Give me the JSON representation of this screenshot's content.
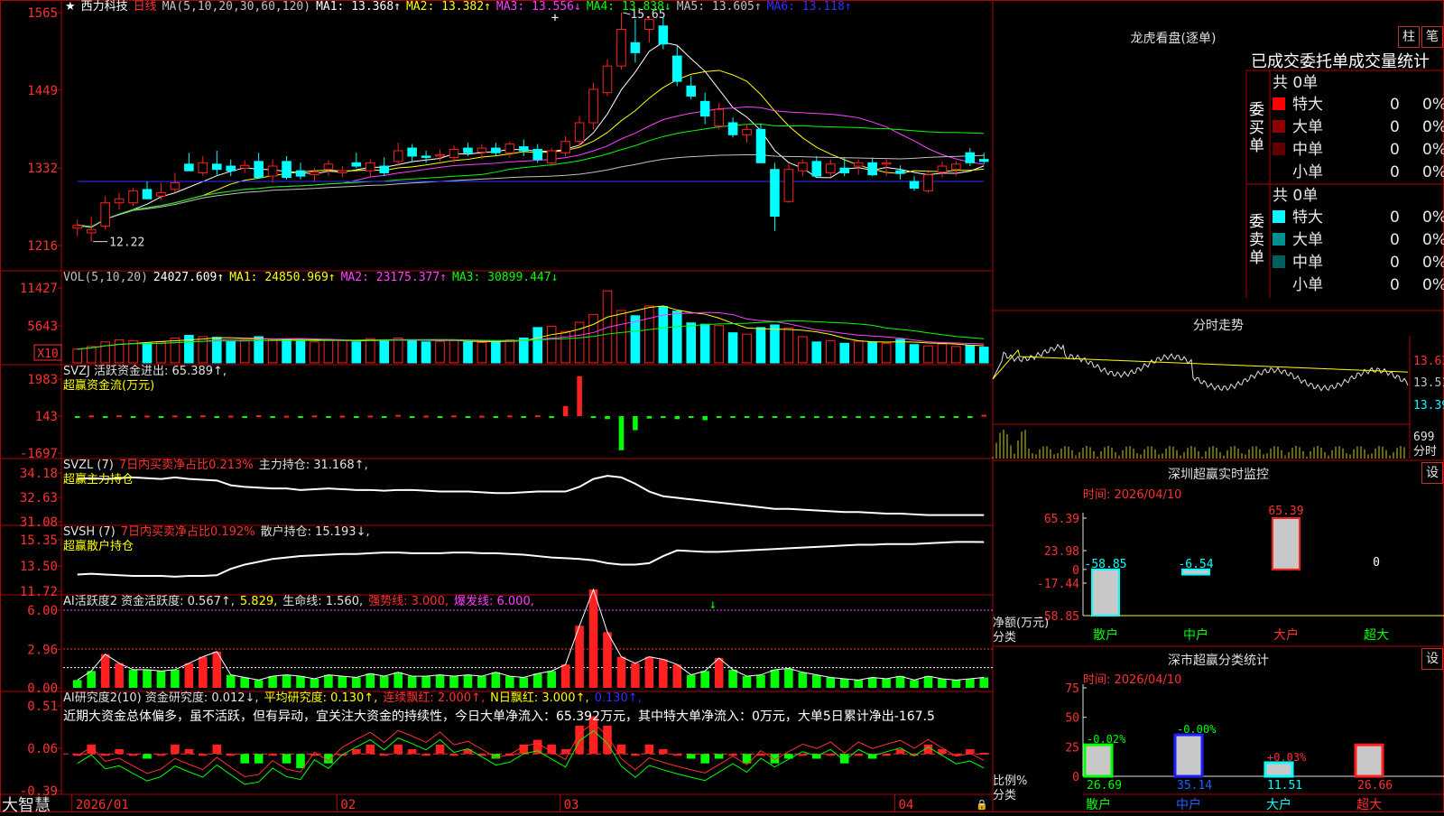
{
  "stock": {
    "name": "西力科技",
    "period": "日线"
  },
  "main": {
    "ma_header": "MA(5,10,20,30,60,120)",
    "ma": [
      {
        "label": "MA1: 13.368↑",
        "color": "#ffffff"
      },
      {
        "label": "MA2: 13.382↑",
        "color": "#ffff00"
      },
      {
        "label": "MA3: 13.556↓",
        "color": "#ff40ff"
      },
      {
        "label": "MA4: 13.838↓",
        "color": "#00ff00"
      },
      {
        "label": "MA5: 13.605↑",
        "color": "#c0c0c0"
      },
      {
        "label": "MA6: 13.118↑",
        "color": "#3030ff"
      }
    ],
    "y_ticks": [
      "1565",
      "1449",
      "1332",
      "1216"
    ],
    "high_label": "15.65",
    "low_label": "12.22"
  },
  "vol": {
    "header": "VOL(5,10,20)",
    "value": "24027.609↑",
    "ma": [
      {
        "label": "MA1: 24850.969↑",
        "color": "#ffff00"
      },
      {
        "label": "MA2: 23175.377↑",
        "color": "#ff40ff"
      },
      {
        "label": "MA3: 30899.447↓",
        "color": "#00ff00"
      }
    ],
    "y_ticks": [
      "11427",
      "5643"
    ],
    "unit": "X10"
  },
  "svzj": {
    "header": "SVZJ  活跃资金进出: 65.389↑,",
    "sub": "超赢资金流(万元)",
    "y_ticks": [
      "1983",
      "143",
      "-1697"
    ]
  },
  "svzl": {
    "header_a": "SVZL (7)",
    "header_b": "7日内买卖净占比0.213%",
    "header_c": "主力持仓: 31.168↑,",
    "sub": "超赢主力持仓",
    "y_ticks": [
      "34.18",
      "32.63",
      "31.08"
    ]
  },
  "svsh": {
    "header_a": "SVSH (7)",
    "header_b": "7日内买卖净占比0.192%",
    "header_c": "散户持仓: 15.193↓,",
    "sub": "超赢散户持仓",
    "y_ticks": [
      "15.35",
      "13.50",
      "11.72"
    ]
  },
  "ai2": {
    "header_a": "AI活跃度2 资金活跃度: 0.567↑,",
    "header_b": "5.829,",
    "header_c": "生命线: 1.560,",
    "header_d": "强势线: 3.000,",
    "header_e": "爆发线: 6.000,",
    "y_ticks": [
      "6.00",
      "2.96",
      "0.00"
    ]
  },
  "ai3": {
    "header_a": "AI研究度2(10) 资金研究度: 0.012↓,",
    "header_b": "平均研究度: 0.130↑,",
    "header_c": "连续飘红: 2.000↑,",
    "header_d": "N日飘红: 3.000↑,",
    "header_e": "0.130↑,",
    "comment": "近期大资金总体偏多，虽不活跃，但有异动，宜关注大资金的持续性，今日大单净流入：65.392万元，其中特大单净流入：0万元，大单5日累计净出-167.5",
    "y_ticks": [
      "0.51",
      "0.06",
      "-0.39"
    ]
  },
  "xaxis": {
    "labels": [
      "2026/01",
      "02",
      "03",
      "04"
    ]
  },
  "brand": "大智慧",
  "right": {
    "lhkp_title": "龙虎看盘(逐单)",
    "btn_zhu": "柱",
    "btn_bi": "笔",
    "stat_title": "已成交委托单成交量统计",
    "buy_label": "委买单",
    "sell_label": "委卖单",
    "buy_total": "共 0单",
    "sell_total": "共 0单",
    "buy_rows": [
      {
        "label": "特大",
        "val": "0",
        "pct": "0%",
        "color": "#ff0000"
      },
      {
        "label": "大单",
        "val": "0",
        "pct": "0%",
        "color": "#900000"
      },
      {
        "label": "中单",
        "val": "0",
        "pct": "0%",
        "color": "#600000"
      },
      {
        "label": "小单",
        "val": "0",
        "pct": "0%",
        "color": "#000000"
      }
    ],
    "sell_rows": [
      {
        "label": "特大",
        "val": "0",
        "pct": "0%",
        "color": "#00ffff"
      },
      {
        "label": "大单",
        "val": "0",
        "pct": "0%",
        "color": "#009090"
      },
      {
        "label": "中单",
        "val": "0",
        "pct": "0%",
        "color": "#006060"
      },
      {
        "label": "小单",
        "val": "0",
        "pct": "0%",
        "color": "#000000"
      }
    ],
    "fst_title": "分时走势",
    "fst_labels": [
      "13.63",
      "13.51",
      "13.39"
    ],
    "fst_vol": "699",
    "fst_vol_unit": "分时",
    "sz_title": "深圳超赢实时监控",
    "btn_she": "设",
    "sz_time": "时间: 2026/04/10",
    "sz_ticks": [
      "65.39",
      "23.98",
      "0",
      "-17.44",
      "-58.85"
    ],
    "sz_values": [
      {
        "cat": "散户",
        "val": -58.85,
        "label": "-58.85",
        "color": "#00ffff"
      },
      {
        "cat": "中户",
        "val": -6.54,
        "label": "-6.54",
        "color": "#00ffff"
      },
      {
        "cat": "大户",
        "val": 65.39,
        "label": "65.39",
        "color": "#ff2020"
      },
      {
        "cat": "超大",
        "val": 0,
        "label": "0",
        "color": "#ffffff"
      }
    ],
    "sz_ylabel": "净额(万元)",
    "sz_xlabel": "分类",
    "ss_title": "深市超赢分类统计",
    "ss_time": "时间: 2026/04/10",
    "ss_ticks": [
      "75",
      "50",
      "25",
      "0"
    ],
    "ss_values": [
      {
        "cat": "散户",
        "val": 26.69,
        "label": "26.69",
        "delta": "-0.02%",
        "color": "#00ff00"
      },
      {
        "cat": "中户",
        "val": 35.14,
        "label": "35.14",
        "delta": "-0.00%",
        "color": "#2020ff"
      },
      {
        "cat": "大户",
        "val": 11.51,
        "label": "11.51",
        "delta": "+0.03%",
        "color": "#00ffff"
      },
      {
        "cat": "超大",
        "val": 26.66,
        "label": "26.66",
        "delta": "",
        "color": "#ff2020"
      }
    ],
    "ss_ylabel": "比例%",
    "ss_xlabel": "分类"
  },
  "colors": {
    "up": "#ff2020",
    "down": "#00ffff",
    "grid": "#b00000",
    "label": "#ff3030"
  },
  "chart_data": {
    "type": "candlestick",
    "ylim": [
      12.16,
      15.65
    ],
    "candles": [
      [
        12.42,
        12.55,
        12.3,
        12.46
      ],
      [
        12.35,
        12.6,
        12.22,
        12.4
      ],
      [
        12.45,
        12.9,
        12.4,
        12.8
      ],
      [
        12.8,
        12.95,
        12.7,
        12.86
      ],
      [
        12.8,
        13.02,
        12.75,
        12.98
      ],
      [
        13.0,
        13.12,
        12.9,
        12.86
      ],
      [
        12.9,
        13.1,
        12.85,
        12.95
      ],
      [
        13.0,
        13.25,
        12.95,
        13.1
      ],
      [
        13.38,
        13.55,
        13.3,
        13.28
      ],
      [
        13.25,
        13.5,
        13.2,
        13.4
      ],
      [
        13.38,
        13.58,
        13.2,
        13.3
      ],
      [
        13.35,
        13.45,
        13.2,
        13.28
      ],
      [
        13.32,
        13.44,
        13.25,
        13.36
      ],
      [
        13.42,
        13.55,
        13.2,
        13.18
      ],
      [
        13.2,
        13.45,
        13.1,
        13.35
      ],
      [
        13.42,
        13.5,
        13.15,
        13.18
      ],
      [
        13.28,
        13.4,
        13.15,
        13.2
      ],
      [
        13.22,
        13.32,
        13.12,
        13.26
      ],
      [
        13.3,
        13.44,
        13.2,
        13.38
      ],
      [
        13.25,
        13.35,
        13.18,
        13.28
      ],
      [
        13.4,
        13.55,
        13.32,
        13.35
      ],
      [
        13.28,
        13.45,
        13.18,
        13.4
      ],
      [
        13.35,
        13.48,
        13.2,
        13.25
      ],
      [
        13.42,
        13.7,
        13.35,
        13.58
      ],
      [
        13.62,
        13.68,
        13.42,
        13.5
      ],
      [
        13.5,
        13.58,
        13.4,
        13.48
      ],
      [
        13.5,
        13.6,
        13.42,
        13.52
      ],
      [
        13.48,
        13.66,
        13.4,
        13.6
      ],
      [
        13.62,
        13.7,
        13.5,
        13.55
      ],
      [
        13.56,
        13.68,
        13.45,
        13.62
      ],
      [
        13.62,
        13.7,
        13.5,
        13.55
      ],
      [
        13.55,
        13.72,
        13.48,
        13.68
      ],
      [
        13.64,
        13.75,
        13.5,
        13.58
      ],
      [
        13.6,
        13.68,
        13.4,
        13.45
      ],
      [
        13.4,
        13.62,
        13.35,
        13.58
      ],
      [
        13.55,
        13.8,
        13.5,
        13.72
      ],
      [
        13.72,
        14.1,
        13.65,
        14.0
      ],
      [
        14.0,
        14.6,
        13.9,
        14.5
      ],
      [
        14.45,
        14.95,
        14.4,
        14.85
      ],
      [
        14.85,
        15.65,
        14.8,
        15.4
      ],
      [
        15.2,
        15.55,
        14.9,
        15.05
      ],
      [
        15.4,
        15.6,
        15.2,
        15.55
      ],
      [
        15.45,
        15.58,
        15.1,
        15.18
      ],
      [
        15.0,
        15.15,
        14.55,
        14.62
      ],
      [
        14.55,
        14.7,
        14.35,
        14.4
      ],
      [
        14.32,
        14.45,
        13.98,
        14.1
      ],
      [
        13.95,
        14.3,
        13.9,
        14.2
      ],
      [
        14.0,
        14.08,
        13.78,
        13.82
      ],
      [
        13.82,
        13.98,
        13.7,
        13.9
      ],
      [
        13.9,
        13.98,
        13.4,
        13.4
      ],
      [
        13.3,
        13.4,
        12.38,
        12.6
      ],
      [
        12.82,
        13.38,
        12.8,
        13.3
      ],
      [
        13.28,
        13.45,
        13.2,
        13.4
      ],
      [
        13.42,
        13.5,
        13.2,
        13.2
      ],
      [
        13.25,
        13.45,
        13.18,
        13.38
      ],
      [
        13.32,
        13.48,
        13.2,
        13.25
      ],
      [
        13.35,
        13.45,
        13.22,
        13.4
      ],
      [
        13.4,
        13.48,
        13.2,
        13.22
      ],
      [
        13.38,
        13.45,
        13.2,
        13.4
      ],
      [
        13.28,
        13.36,
        13.15,
        13.24
      ],
      [
        13.12,
        13.2,
        12.98,
        13.02
      ],
      [
        12.98,
        13.26,
        12.95,
        13.22
      ],
      [
        13.26,
        13.42,
        13.18,
        13.35
      ],
      [
        13.3,
        13.42,
        13.2,
        13.38
      ],
      [
        13.55,
        13.62,
        13.35,
        13.4
      ],
      [
        13.45,
        13.55,
        13.38,
        13.42
      ]
    ],
    "volumes": [
      2.1,
      2.5,
      3.2,
      3.5,
      3.4,
      3.0,
      3.2,
      3.8,
      4.2,
      4.0,
      3.9,
      3.3,
      3.4,
      4.0,
      3.5,
      3.6,
      3.4,
      3.2,
      3.6,
      3.4,
      3.2,
      3.7,
      3.3,
      3.8,
      3.5,
      3.2,
      3.3,
      3.4,
      3.2,
      3.1,
      3.3,
      3.5,
      3.8,
      5.4,
      5.6,
      4.8,
      6.2,
      7.4,
      11.0,
      8.0,
      7.2,
      8.7,
      8.6,
      7.9,
      6.1,
      5.9,
      5.7,
      4.6,
      4.4,
      5.4,
      5.8,
      5.3,
      4.0,
      3.2,
      3.4,
      3.0,
      3.3,
      3.2,
      3.0,
      3.6,
      2.8,
      2.6,
      2.9,
      2.5,
      2.7,
      2.4
    ],
    "flows": [
      -40,
      30,
      -20,
      40,
      -30,
      25,
      -40,
      30,
      -20,
      35,
      -30,
      25,
      -60,
      40,
      -35,
      20,
      -25,
      30,
      -45,
      20,
      -30,
      25,
      -35,
      60,
      -30,
      25,
      -20,
      30,
      -40,
      20,
      -35,
      30,
      -25,
      40,
      -60,
      500,
      1983,
      -50,
      -150,
      -1697,
      -700,
      -120,
      -40,
      -150,
      -30,
      -200,
      -60,
      -50,
      -40,
      -70,
      -45,
      -30,
      -40,
      -35,
      -50,
      -60,
      -40,
      -30,
      -45,
      -30,
      -40,
      -35,
      -60,
      -40,
      -30,
      65
    ],
    "zl": [
      33.8,
      33.85,
      33.8,
      33.85,
      33.9,
      33.85,
      33.8,
      33.9,
      33.8,
      33.75,
      33.7,
      33.4,
      33.3,
      33.25,
      33.2,
      33.2,
      33.1,
      33.15,
      33.2,
      33.15,
      33.1,
      33.1,
      33.05,
      33.1,
      33.1,
      33.05,
      33.0,
      33.0,
      33.0,
      32.95,
      32.9,
      32.9,
      32.95,
      33.0,
      33.0,
      33.0,
      33.3,
      33.8,
      34.0,
      33.9,
      33.5,
      33.0,
      32.7,
      32.6,
      32.5,
      32.4,
      32.3,
      32.2,
      32.1,
      32.0,
      31.9,
      31.9,
      31.85,
      31.8,
      31.75,
      31.7,
      31.7,
      31.65,
      31.6,
      31.6,
      31.55,
      31.5,
      31.5,
      31.5,
      31.5,
      31.5
    ],
    "sh": [
      12.9,
      12.95,
      12.9,
      12.85,
      12.8,
      12.8,
      12.8,
      12.75,
      12.8,
      12.8,
      12.85,
      13.3,
      13.6,
      13.8,
      14.0,
      14.1,
      14.2,
      14.25,
      14.3,
      14.35,
      14.35,
      14.4,
      14.45,
      14.45,
      14.4,
      14.4,
      14.4,
      14.45,
      14.45,
      14.4,
      14.4,
      14.35,
      14.3,
      14.2,
      14.1,
      14.05,
      14.0,
      13.9,
      13.7,
      13.6,
      13.6,
      13.7,
      14.2,
      14.6,
      14.55,
      14.5,
      14.5,
      14.55,
      14.6,
      14.65,
      14.7,
      14.75,
      14.8,
      14.85,
      14.9,
      14.95,
      15.0,
      15.0,
      15.05,
      15.05,
      15.05,
      15.1,
      15.15,
      15.2,
      15.2,
      15.19
    ],
    "act": [
      0.6,
      1.3,
      2.6,
      1.9,
      1.4,
      1.4,
      1.3,
      1.4,
      1.9,
      2.4,
      2.8,
      1.0,
      0.8,
      0.6,
      0.9,
      1.0,
      0.9,
      0.7,
      1.0,
      0.9,
      0.8,
      1.1,
      0.9,
      1.2,
      0.9,
      0.9,
      1.0,
      0.9,
      1.0,
      0.9,
      1.2,
      0.9,
      0.8,
      1.1,
      1.3,
      1.8,
      4.8,
      7.6,
      4.3,
      2.4,
      1.9,
      2.4,
      2.2,
      1.8,
      1.0,
      1.3,
      2.3,
      1.4,
      0.9,
      1.0,
      1.4,
      1.5,
      1.2,
      1.0,
      0.8,
      0.7,
      0.6,
      0.8,
      0.7,
      0.9,
      0.6,
      0.9,
      0.7,
      0.6,
      0.7,
      0.8
    ],
    "res": [
      0.0,
      0.1,
      0.0,
      0.05,
      0.0,
      -0.05,
      0.0,
      0.1,
      0.05,
      0.0,
      0.1,
      0.0,
      -0.1,
      -0.1,
      0.0,
      -0.1,
      -0.15,
      0.0,
      -0.1,
      0.0,
      0.05,
      0.1,
      0.0,
      0.1,
      0.05,
      0.0,
      0.1,
      0.0,
      0.05,
      0.0,
      -0.05,
      0.0,
      0.1,
      0.15,
      0.1,
      0.05,
      0.3,
      0.4,
      0.3,
      0.1,
      0.0,
      0.1,
      0.05,
      0.0,
      -0.05,
      -0.1,
      -0.05,
      0.0,
      -0.1,
      0.0,
      -0.1,
      -0.05,
      0.0,
      -0.05,
      0.0,
      -0.1,
      0.0,
      -0.05,
      0.0,
      0.05,
      0.0,
      0.1,
      0.05,
      0.0,
      0.05,
      0.012
    ]
  }
}
